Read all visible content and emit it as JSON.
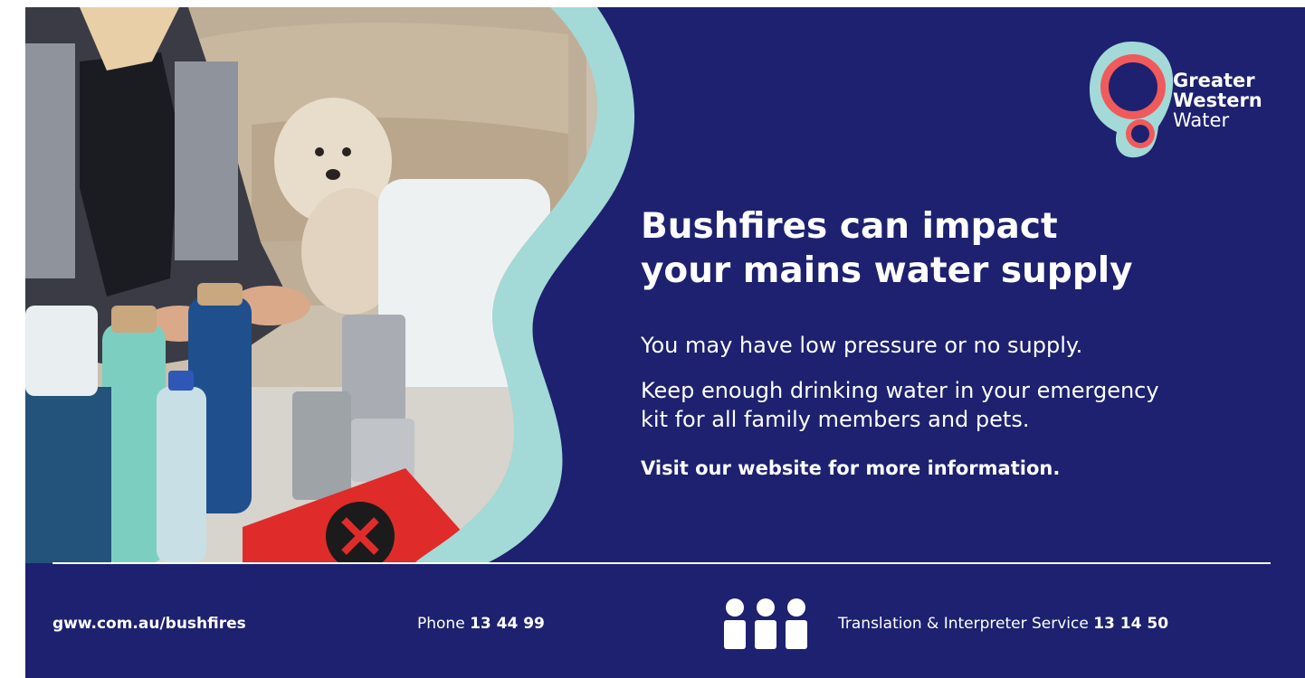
{
  "brand": {
    "name_line1": "Greater",
    "name_line2": "Western",
    "name_line3": "Water",
    "colors": {
      "navy": "#1d2170",
      "aqua": "#a3d9d6",
      "coral": "#f05a5b",
      "white": "#ffffff"
    }
  },
  "headline": {
    "line1": "Bushfires can impact",
    "line2": "your mains water supply"
  },
  "body": {
    "para1": "You may have low pressure or no supply.",
    "para2_line1": "Keep enough drinking water in your emergency",
    "para2_line2": "kit for all family members and pets.",
    "cta": "Visit our website for more information."
  },
  "footer": {
    "url": "gww.com.au/bushfires",
    "phone_label": "Phone",
    "phone_number": "13 44 99",
    "tis_label": "Translation & Interpreter Service",
    "tis_number": "13 14 50",
    "tis_icon": "interpreter-people-icon"
  }
}
